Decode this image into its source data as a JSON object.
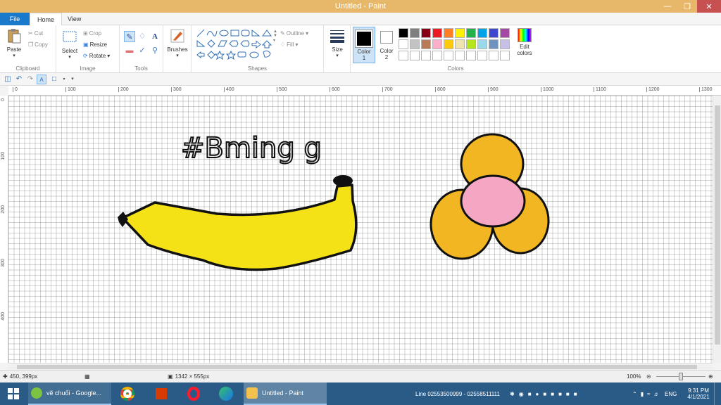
{
  "window": {
    "title": "Untitled - Paint"
  },
  "tabs": {
    "file": "File",
    "home": "Home",
    "view": "View"
  },
  "clipboard": {
    "paste": "Paste",
    "cut": "Cut",
    "copy": "Copy",
    "label": "Clipboard"
  },
  "image": {
    "select": "Select",
    "crop": "Crop",
    "resize": "Resize",
    "rotate": "Rotate",
    "label": "Image"
  },
  "tools": {
    "label": "Tools",
    "text_tool": "A"
  },
  "brushes": {
    "label": "Brushes"
  },
  "shapes": {
    "outline": "Outline",
    "fill": "Fill",
    "label": "Shapes"
  },
  "size": {
    "label": "Size"
  },
  "color1": {
    "label": "Color",
    "num": "1"
  },
  "color2": {
    "label": "Color",
    "num": "2"
  },
  "colors": {
    "label": "Colors",
    "edit": "Edit",
    "edit2": "colors",
    "row1": [
      "#000000",
      "#7f7f7f",
      "#880015",
      "#ed1c24",
      "#ff7f27",
      "#fff200",
      "#22b14c",
      "#00a2e8",
      "#3f48cc",
      "#a349a4"
    ],
    "row2": [
      "#ffffff",
      "#c3c3c3",
      "#b97a57",
      "#ffaec9",
      "#ffc90e",
      "#efe4b0",
      "#b5e61d",
      "#99d9ea",
      "#7092be",
      "#c8bfe7"
    ],
    "row3": [
      "#ffffff",
      "#ffffff",
      "#ffffff",
      "#ffffff",
      "#ffffff",
      "#ffffff",
      "#ffffff",
      "#ffffff",
      "#ffffff",
      "#ffffff"
    ]
  },
  "ruler": {
    "top": [
      "0",
      "100",
      "200",
      "300",
      "400",
      "500",
      "600",
      "700",
      "800",
      "900",
      "1000",
      "1100",
      "1200",
      "1300"
    ],
    "left": [
      "0",
      "100",
      "200",
      "300",
      "400"
    ]
  },
  "canvas": {
    "handwriting": "#Bming g"
  },
  "status": {
    "cursor": "450, 399px",
    "size": "1342 × 555px",
    "zoom": "100%"
  },
  "taskbar": {
    "task1": "vẽ chuối - Google...",
    "task2": "Untitled - Paint",
    "line_text": "Line 02553500999 - 02558511111",
    "lang": "ENG",
    "time": "9:31 PM",
    "date": "4/1/2021"
  }
}
